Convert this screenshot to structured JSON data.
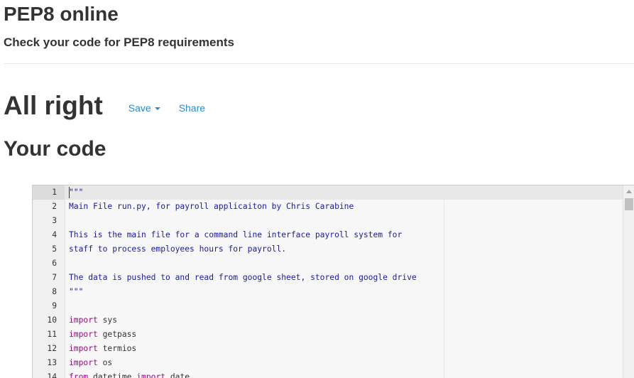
{
  "header": {
    "title": "PEP8 online",
    "subtitle": "Check your code for PEP8 requirements"
  },
  "result": {
    "title": "All right",
    "save_label": "Save",
    "share_label": "Share"
  },
  "code_section": {
    "title": "Your code"
  },
  "editor": {
    "lines": [
      {
        "num": "1",
        "text": "\"\"\""
      },
      {
        "num": "2",
        "text": "Main File run.py, for payroll applicaiton by Chris Carabine"
      },
      {
        "num": "3",
        "text": ""
      },
      {
        "num": "4",
        "text": "This is the main file for a command line interface payroll system for"
      },
      {
        "num": "5",
        "text": "staff to process employees hours for payroll."
      },
      {
        "num": "6",
        "text": ""
      },
      {
        "num": "7",
        "text": "The data is pushed to and read from google sheet, stored on google drive"
      },
      {
        "num": "8",
        "text": "\"\"\""
      },
      {
        "num": "9",
        "text": ""
      },
      {
        "num": "10",
        "kw": "import",
        "rest": " sys"
      },
      {
        "num": "11",
        "kw": "import",
        "rest": " getpass"
      },
      {
        "num": "12",
        "kw": "import",
        "rest": " termios"
      },
      {
        "num": "13",
        "kw": "import",
        "rest": " os"
      },
      {
        "num": "14",
        "kw": "from",
        "mid": " datetime ",
        "kw2": "import",
        "rest": " date"
      }
    ]
  },
  "colors": {
    "link": "#2a8ac4",
    "string": "#1a1aa6",
    "keyword": "#930f80"
  }
}
